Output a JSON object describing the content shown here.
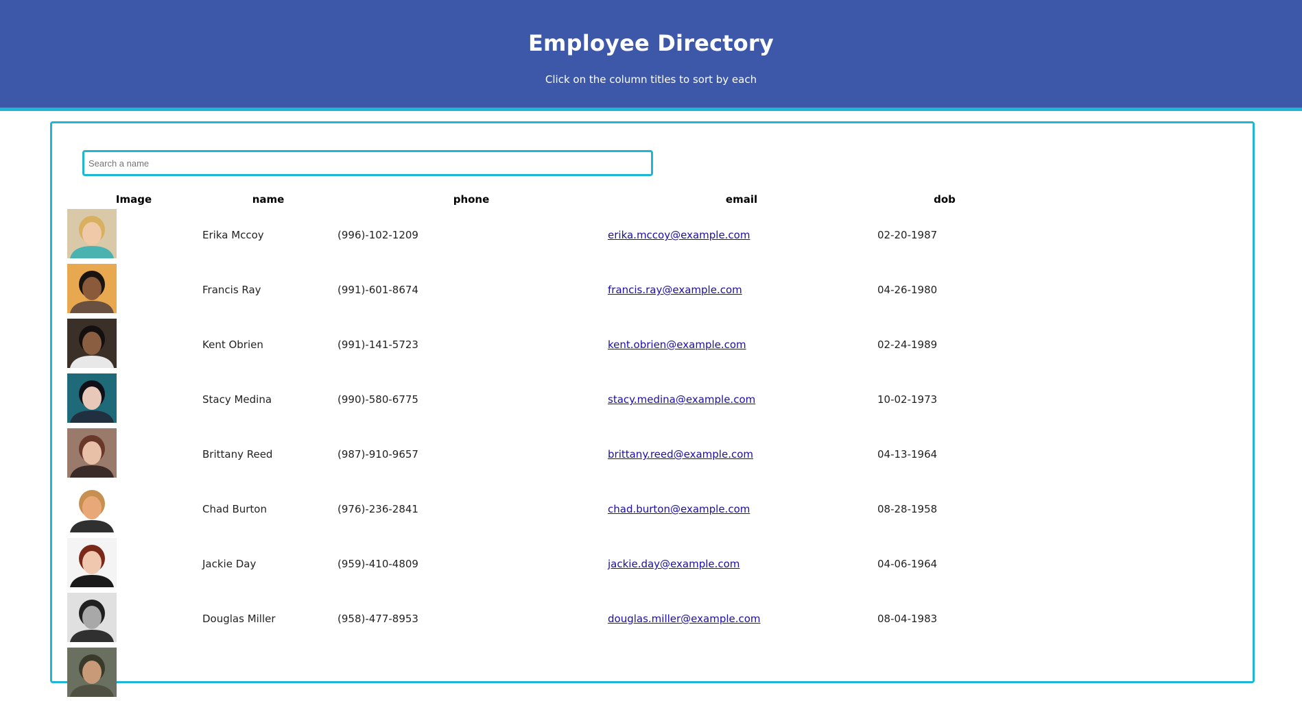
{
  "header": {
    "title": "Employee Directory",
    "subtitle": "Click on the column titles to sort by each"
  },
  "search": {
    "placeholder": "Search a name",
    "value": ""
  },
  "columns": [
    "Image",
    "name",
    "phone",
    "email",
    "dob"
  ],
  "employees": [
    {
      "name": "Erika Mccoy",
      "phone": "(996)-102-1209",
      "email": "erika.mccoy@example.com",
      "dob": "02-20-1987",
      "avatar_bg": "#d9c9a8",
      "skin": "#f0c9a8",
      "hair": "#d8b060",
      "shirt": "#4ab3b0"
    },
    {
      "name": "Francis Ray",
      "phone": "(991)-601-8674",
      "email": "francis.ray@example.com",
      "dob": "04-26-1980",
      "avatar_bg": "#e8a850",
      "skin": "#8a5a3a",
      "hair": "#1a1410",
      "shirt": "#6a5040"
    },
    {
      "name": "Kent Obrien",
      "phone": "(991)-141-5723",
      "email": "kent.obrien@example.com",
      "dob": "02-24-1989",
      "avatar_bg": "#3a3028",
      "skin": "#8a5e40",
      "hair": "#151010",
      "shirt": "#e8e8e8"
    },
    {
      "name": "Stacy Medina",
      "phone": "(990)-580-6775",
      "email": "stacy.medina@example.com",
      "dob": "10-02-1973",
      "avatar_bg": "#1e6a78",
      "skin": "#e8c8b8",
      "hair": "#101018",
      "shirt": "#203040"
    },
    {
      "name": "Brittany Reed",
      "phone": "(987)-910-9657",
      "email": "brittany.reed@example.com",
      "dob": "04-13-1964",
      "avatar_bg": "#9a7a6a",
      "skin": "#e8c0a8",
      "hair": "#6a3828",
      "shirt": "#3a2a28"
    },
    {
      "name": "Chad Burton",
      "phone": "(976)-236-2841",
      "email": "chad.burton@example.com",
      "dob": "08-28-1958",
      "avatar_bg": "#ffffff",
      "skin": "#e8a878",
      "hair": "#c89050",
      "shirt": "#303030"
    },
    {
      "name": "Jackie Day",
      "phone": "(959)-410-4809",
      "email": "jackie.day@example.com",
      "dob": "04-06-1964",
      "avatar_bg": "#f4f4f4",
      "skin": "#f0c8b0",
      "hair": "#7a2818",
      "shirt": "#1a1a1a"
    },
    {
      "name": "Douglas Miller",
      "phone": "(958)-477-8953",
      "email": "douglas.miller@example.com",
      "dob": "08-04-1983",
      "avatar_bg": "#e0e0e0",
      "skin": "#a8a8a8",
      "hair": "#202020",
      "shirt": "#303030"
    },
    {
      "name": "",
      "phone": "",
      "email": "",
      "dob": "",
      "avatar_bg": "#6a7060",
      "skin": "#c89a78",
      "hair": "#3a3a2a",
      "shirt": "#505040"
    }
  ]
}
